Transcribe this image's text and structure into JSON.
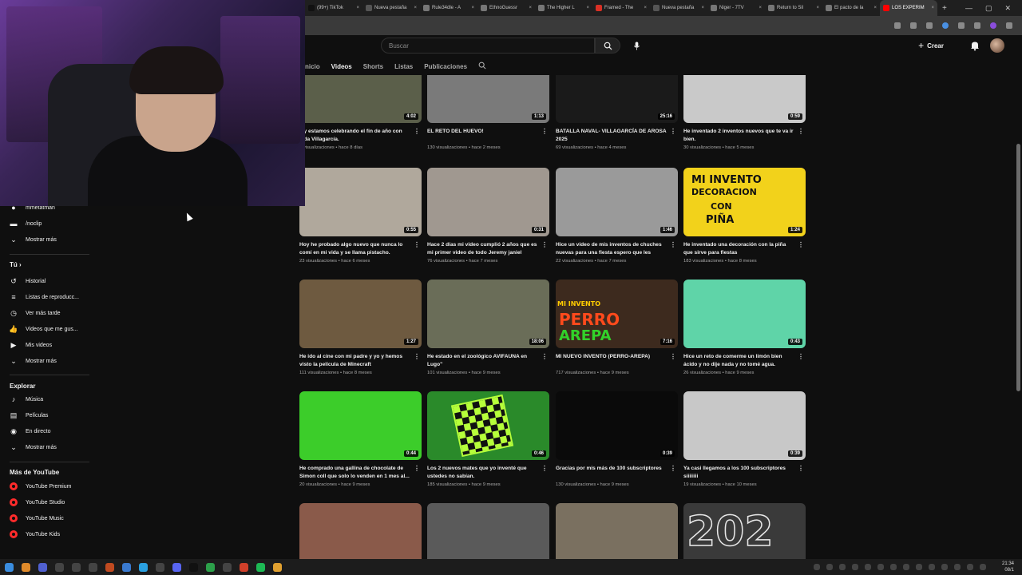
{
  "browser": {
    "tabs": [
      {
        "label": "(99+) TikTok",
        "color": "#111111"
      },
      {
        "label": "Nueva pestaña",
        "color": "#555555"
      },
      {
        "label": "Rule34dle - A",
        "color": "#777777"
      },
      {
        "label": "EthnoGuessr",
        "color": "#777777"
      },
      {
        "label": "The Higher L",
        "color": "#777777"
      },
      {
        "label": "Framed - The",
        "color": "#d93025"
      },
      {
        "label": "Nueva pestaña",
        "color": "#555555"
      },
      {
        "label": "Niger - 7TV",
        "color": "#777777"
      },
      {
        "label": "Return to Sil",
        "color": "#777777"
      },
      {
        "label": "El pacto de la",
        "color": "#777777"
      },
      {
        "label": "LOS EXPERIM",
        "color": "#ff0000"
      }
    ],
    "window_controls": [
      "—",
      "▢",
      "✕"
    ]
  },
  "yt_header": {
    "search_placeholder": "Buscar",
    "create_label": "Crear",
    "create_plus": "+"
  },
  "channel_tabs": [
    "nicio",
    "Videos",
    "Shorts",
    "Listas",
    "Publicaciones"
  ],
  "channel_tabs_active": "Videos",
  "sidebar": {
    "subscriptions_partial": [
      {
        "label": "mmetatman",
        "icon": "avatar-icon"
      },
      {
        "label": "/noclip",
        "icon": "channel-avatar-icon"
      },
      {
        "label": "Mostrar más",
        "icon": "chevron-down-icon"
      }
    ],
    "tu_heading": "Tú",
    "tu_arrow": "›",
    "tu_items": [
      {
        "label": "Historial",
        "icon": "history-icon"
      },
      {
        "label": "Listas de reproducc...",
        "icon": "playlist-icon"
      },
      {
        "label": "Ver más tarde",
        "icon": "clock-icon"
      },
      {
        "label": "Videos que me gus...",
        "icon": "thumbs-up-icon"
      },
      {
        "label": "Mis videos",
        "icon": "my-videos-icon"
      },
      {
        "label": "Mostrar más",
        "icon": "chevron-down-icon"
      }
    ],
    "explore_heading": "Explorar",
    "explore_items": [
      {
        "label": "Música",
        "icon": "music-icon"
      },
      {
        "label": "Películas",
        "icon": "film-icon"
      },
      {
        "label": "En directo",
        "icon": "live-icon"
      },
      {
        "label": "Mostrar más",
        "icon": "chevron-down-icon"
      }
    ],
    "more_heading": "Más de YouTube",
    "more_items": [
      {
        "label": "YouTube Premium",
        "icon": "youtube-premium-icon"
      },
      {
        "label": "YouTube Studio",
        "icon": "youtube-studio-icon"
      },
      {
        "label": "YouTube Music",
        "icon": "youtube-music-icon"
      },
      {
        "label": "YouTube Kids",
        "icon": "youtube-kids-icon"
      }
    ]
  },
  "videos": [
    {
      "title": "...y estamos celebrando el fin de año con ...da Villagarcía.",
      "meta": "...visualizaciones • hace 8 días",
      "duration": "4:02",
      "bg": "#5b5f4a"
    },
    {
      "title": "EL RETO DEL HUEVO!",
      "meta": "130 visualizaciones • hace 2 meses",
      "duration": "1:13",
      "bg": "#7a7a7a"
    },
    {
      "title": "BATALLA NAVAL- VILLAGARCÍA DE AROSA 2025",
      "meta": "69 visualizaciones • hace 4 meses",
      "duration": "25:16",
      "bg": "#1a1a1a"
    },
    {
      "title": "He inventado 2 inventos nuevos que te va ir bien.",
      "meta": "30 visualizaciones • hace 5 meses",
      "duration": "0:59",
      "bg": "#c9c9c9"
    },
    {
      "title": "Hoy he probado algo nuevo que nunca lo comí en mi vida y se llama pistacho.",
      "meta": "23 visualizaciones • hace 6 meses",
      "duration": "0:55",
      "bg": "#b0a89c"
    },
    {
      "title": "Hace 2 días mi video cumplió 2 años que es mi primer video de todo Jeremy janiel",
      "meta": "76 visualizaciones • hace 7 meses",
      "duration": "0:31",
      "bg": "#a09890"
    },
    {
      "title": "Hice un video de mis inventos de chuches nuevas para una fiesta espero que les guste.",
      "meta": "22 visualizaciones • hace 7 meses",
      "duration": "1:46",
      "bg": "#9a9a9a"
    },
    {
      "title": "He inventado una decoración con la piña que sirve para fiestas",
      "meta": "183 visualizaciones • hace 8 meses",
      "duration": "1:24",
      "bg": "#f2d21b"
    },
    {
      "title": "He ido al cine con mi padre y yo y hemos visto la película de Minecraft",
      "meta": "111 visualizaciones • hace 8 meses",
      "duration": "1:27",
      "bg": "#6e5a40"
    },
    {
      "title": "He estado en el zoológico AVIFAUNA en Lugo\"",
      "meta": "101 visualizaciones • hace 9 meses",
      "duration": "18:06",
      "bg": "#6a6d58"
    },
    {
      "title": "MI NUEVO INVENTO (PERRO-AREPA)",
      "meta": "717 visualizaciones • hace 9 meses",
      "duration": "7:16",
      "bg": "#3d2a1e"
    },
    {
      "title": "Hice un reto de comerme un limón bien ácido y no dije nada y no tomé agua.",
      "meta": "26 visualizaciones • hace 9 meses",
      "duration": "0:43",
      "bg": "#5fd4a8"
    },
    {
      "title": "He comprado una gallina de chocolate de Simon coll que solo lo venden en 1 mes al...",
      "meta": "20 visualizaciones • hace 9 meses",
      "duration": "0:44",
      "bg": "#3ccd2a"
    },
    {
      "title": "Los 2 nuevos mates que yo inventé que ustedes no sabían.",
      "meta": "185 visualizaciones • hace 9 meses",
      "duration": "0:46",
      "bg": "#2a8a2a"
    },
    {
      "title": "Gracias por mis más de 100 subscriptores",
      "meta": "130 visualizaciones • hace 9 meses",
      "duration": "0:39",
      "bg": "#0a0a0a"
    },
    {
      "title": "Ya casi llegamos a los 100 subscriptores siiiiiiii",
      "meta": "19 visualizaciones • hace 10 meses",
      "duration": "0:39",
      "bg": "#c8c8c8"
    },
    {
      "title": "",
      "meta": "",
      "duration": "",
      "bg": "#8a5a4a"
    },
    {
      "title": "",
      "meta": "",
      "duration": "",
      "bg": "#5a5a5a"
    },
    {
      "title": "",
      "meta": "",
      "duration": "",
      "bg": "#7a7060"
    },
    {
      "title": "",
      "meta": "",
      "duration": "",
      "bg": "#3a3a3a"
    }
  ],
  "thumb_overlays": {
    "invento": [
      "MI INVENTO",
      "DECORACION",
      "CON",
      "PIÑA"
    ],
    "perro": [
      "MI INVENTO",
      "PERRO",
      "AREPA"
    ],
    "year": "202"
  },
  "taskbar": {
    "time": "21:34",
    "date": "08/1"
  }
}
